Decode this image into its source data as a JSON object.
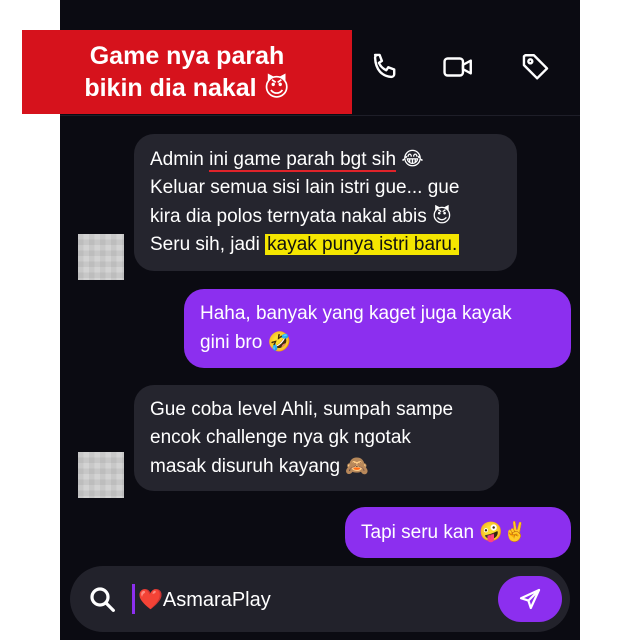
{
  "banner": {
    "line1": "Game nya parah",
    "line2": "bikin dia nakal",
    "emoji": "😈"
  },
  "header": {
    "icons": [
      "phone-icon",
      "video-camera-icon",
      "tag-icon"
    ]
  },
  "colors": {
    "background": "#0b0b12",
    "incoming_bubble": "#25252e",
    "outgoing_bubble": "#8c2fef",
    "banner": "#d6121c",
    "highlight": "#f4e600",
    "underline": "#e0232a"
  },
  "messages": [
    {
      "direction": "incoming",
      "l1_pre": "Admin ",
      "l1_underlined": "ini game parah bgt sih",
      "l1_emoji": "😂",
      "l2": "Keluar semua sisi lain istri gue... gue",
      "l3_text": "kira dia polos ternyata nakal abis",
      "l3_emoji": "😈",
      "l4_pre": "Seru sih, jadi ",
      "l4_highlight": "kayak punya istri baru."
    },
    {
      "direction": "outgoing",
      "l1": "Haha, banyak yang kaget juga kayak",
      "l2_text": "gini bro",
      "l2_emoji": "🤣"
    },
    {
      "direction": "incoming",
      "l1": "Gue coba level Ahli, sumpah sampe",
      "l2": "encok challenge nya gk ngotak",
      "l3_text": "masak disuruh kayang",
      "l3_emoji": "🙈"
    },
    {
      "direction": "outgoing",
      "l1_text": "Tapi seru kan",
      "l1_emoji": "🤪✌️"
    }
  ],
  "composer": {
    "heart": "❤️",
    "text": "AsmaraPlay",
    "left_icon": "search-icon",
    "send_icon": "send-arrow-icon"
  }
}
